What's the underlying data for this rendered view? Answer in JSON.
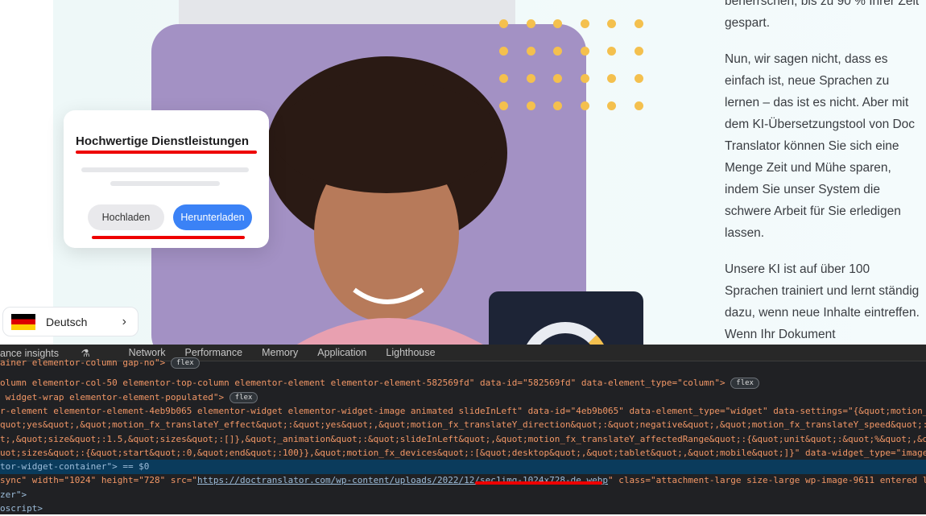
{
  "page": {
    "card": {
      "title": "Hochwertige Dienstleistungen",
      "upload": "Hochladen",
      "download": "Herunterladen"
    },
    "language": {
      "label": "Deutsch",
      "flag": "german-flag",
      "chevron": "›"
    },
    "text": {
      "p0": "beherrschen, bis zu 90 % Ihrer Zeit gespart.",
      "p1": "Nun, wir sagen nicht, dass es einfach ist, neue Sprachen zu lernen – das ist es nicht. Aber mit dem KI-Übersetzungstool von Doc Translator können Sie sich eine Menge Zeit und Mühe sparen, indem Sie unser System die schwere Arbeit für Sie erledigen lassen.",
      "p2": "Unsere KI ist auf über 100 Sprachen trainiert und lernt ständig dazu, wenn neue Inhalte eintreffen. Wenn Ihr Dokument"
    },
    "colors": {
      "accent": "#3b82f6",
      "dots": "#f4c04e",
      "highlight": "#e00000"
    }
  },
  "devtools": {
    "tabs": [
      "ance insights",
      "Network",
      "Performance",
      "Memory",
      "Application",
      "Lighthouse"
    ],
    "lines": [
      "ainer elementor-column gap-no\">",
      "olumn elementor-col-50 elementor-top-column elementor-element elementor-element-582569fd\" data-id=\"582569fd\" data-element_type=\"column\">",
      " widget-wrap elementor-element-populated\">",
      "r-element elementor-element-4eb9b065 elementor-widget elementor-widget-image animated slideInLeft\" data-id=\"4eb9b065\" data-element_type=\"widget\" data-settings=\"{&quot;motion_fx_",
      "quot;yes&quot;,&quot;motion_fx_translateY_effect&quot;:&quot;yes&quot;,&quot;motion_fx_translateY_direction&quot;:&quot;negative&quot;,&quot;motion_fx_translateY_speed&quot;:{",
      "t;,&quot;size&quot;:1.5,&quot;sizes&quot;:[]},&quot;_animation&quot;:&quot;slideInLeft&quot;,&quot;motion_fx_translateY_affectedRange&quot;:{&quot;unit&quot;:&quot;%&quot;,&quot;",
      "uot;sizes&quot;:{&quot;start&quot;:0,&quot;end&quot;:100}},&quot;motion_fx_devices&quot;:[&quot;desktop&quot;,&quot;tablet&quot;,&quot;mobile&quot;]}\" data-widget_type=\"image.",
      "tor-widget-container\"> == $0",
      "sync\" width=\"1024\" height=\"728\" src=\"",
      "zer\">",
      "oscript>"
    ],
    "img_src": "https://doctranslator.com/wp-content/uploads/2022/12/sec1img-1024x728-de.webp",
    "img_rest": "\" class=\"attachment-large size-large wp-image-9611 entered la",
    "badge": "flex"
  }
}
